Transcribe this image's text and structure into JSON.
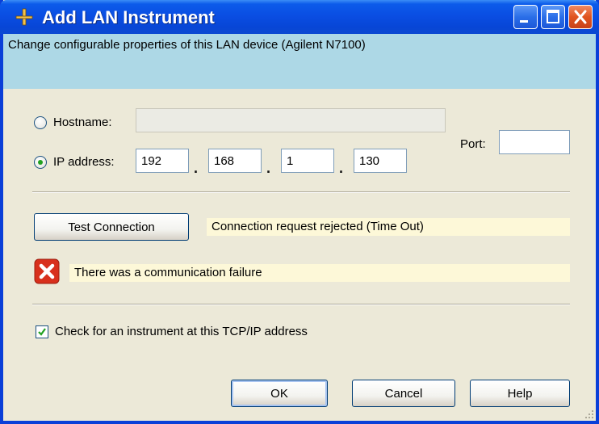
{
  "window": {
    "title": "Add LAN Instrument",
    "icon": "lan-instrument-icon",
    "controls": [
      "minimize",
      "maximize",
      "close"
    ]
  },
  "header": {
    "text": "Change configurable properties of this LAN device (Agilent N7100)"
  },
  "address": {
    "hostname_label": "Hostname:",
    "hostname_value": "",
    "hostname_selected": false,
    "ip_label": "IP address:",
    "ip_selected": true,
    "ip_octets": [
      "192",
      "168",
      "1",
      "130"
    ],
    "separator": ".",
    "port_label": "Port:",
    "port_value": ""
  },
  "test": {
    "button_label": "Test Connection",
    "status_text": "Connection request rejected (Time Out)",
    "error_text": "There was a communication failure",
    "error_icon": "error-icon"
  },
  "check": {
    "label": "Check for an instrument at this TCP/IP address",
    "checked": true
  },
  "buttons": {
    "ok": "OK",
    "cancel": "Cancel",
    "help": "Help"
  },
  "colors": {
    "title_bar": "#0a4ee3",
    "header_band": "#add8e6",
    "status_band": "#fdf8d8",
    "dialog_face": "#ece9d8",
    "error_red": "#d8301c"
  }
}
